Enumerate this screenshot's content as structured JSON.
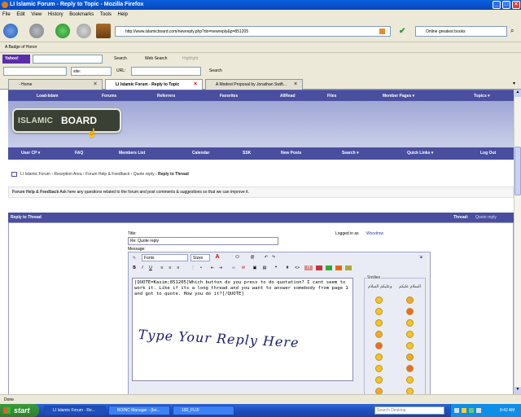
{
  "window": {
    "title": "LI Islamic Forum - Reply to Topic - Mozilla Firefox"
  },
  "menu": [
    "File",
    "Edit",
    "View",
    "History",
    "Bookmarks",
    "Tools",
    "Help"
  ],
  "navbar": {
    "url": "http://www.islamicboard.com/newreply.php?do=newreply&p=851205",
    "search_value": "Online greatest books"
  },
  "bookmarks": {
    "item": "A Badge of Honor"
  },
  "toolbar1": {
    "brand": "Yahoo!",
    "search": "Search",
    "web_search": "Web Search",
    "highlight": "Highlight"
  },
  "toolbar2": {
    "site_label": "site:",
    "url_label": "URL:",
    "search_btn": "Search"
  },
  "tabs": [
    {
      "label": "- Home"
    },
    {
      "label": "LI Islamic Forum - Reply to Topic"
    },
    {
      "label": "A Modest Proposal by Jonathan Swift..."
    }
  ],
  "forum": {
    "topnav": [
      "Load-Islam",
      "Forums",
      "Referrers",
      "Favorites",
      "AllRead",
      "Files",
      "Member Pages ▾",
      "Topics ▾"
    ],
    "logo": {
      "islamic": "ISLAMIC",
      "board": "BOARD",
      ".com": ".COM"
    },
    "subnav": [
      "User CP ▾",
      "FAQ",
      "Members List",
      "Calendar",
      "SSK",
      "New Posts",
      "Search ▾",
      "Quick Links ▾",
      "Log Out"
    ],
    "breadcrumb": {
      "items": [
        "LI Islamic Forum",
        "Reception Area",
        "Forum Help & Feedback",
        "Quote reply"
      ],
      "current": "Reply to Thread"
    },
    "forum_desc": {
      "name": "Forum Help & Feedback",
      "text": "Ask here any questions related to the forum and post comments & suggestions so that we can improve it."
    },
    "reply_header": {
      "title": "Reply to Thread",
      "thread_label": "Thread:",
      "thread_link": "Quote reply"
    },
    "form": {
      "title_label": "Title:",
      "title_value": "Re: Quote reply",
      "logged_in_label": "Logged in as",
      "logged_in_user": "Woodrow",
      "message_label": "Message:",
      "fonts_select": "Fonts",
      "sizes_select": "Sizes",
      "message_text": "[QUOTE=Kasim;851205]Which button do you press to do quotation? I cant seem to work it. Like if its a long thread and you want to answer somebody from page 1 and got to quote. How you do it?[/QUOTE]",
      "handwritten_note": "Type Your Reply Here",
      "smilies_legend": "Smilies",
      "smilies_headers": [
        "السلام عليكم",
        "وعليكم السلام"
      ],
      "smiley_count": 20
    }
  },
  "status": {
    "text": "Done"
  },
  "taskbar": {
    "start": "start",
    "tasks": [
      {
        "label": "LI Islamic Forum - Re..."
      },
      {
        "label": "BOINC Manager - [bo..."
      },
      {
        "label": "100_FUJI"
      }
    ],
    "desktop_search": "Search Desktop",
    "clock": "8:42 AM"
  },
  "colors": {
    "forum_nav": "#4a4e9e",
    "banner": "#b9bfe2",
    "xp_blue": "#1f52c4"
  }
}
